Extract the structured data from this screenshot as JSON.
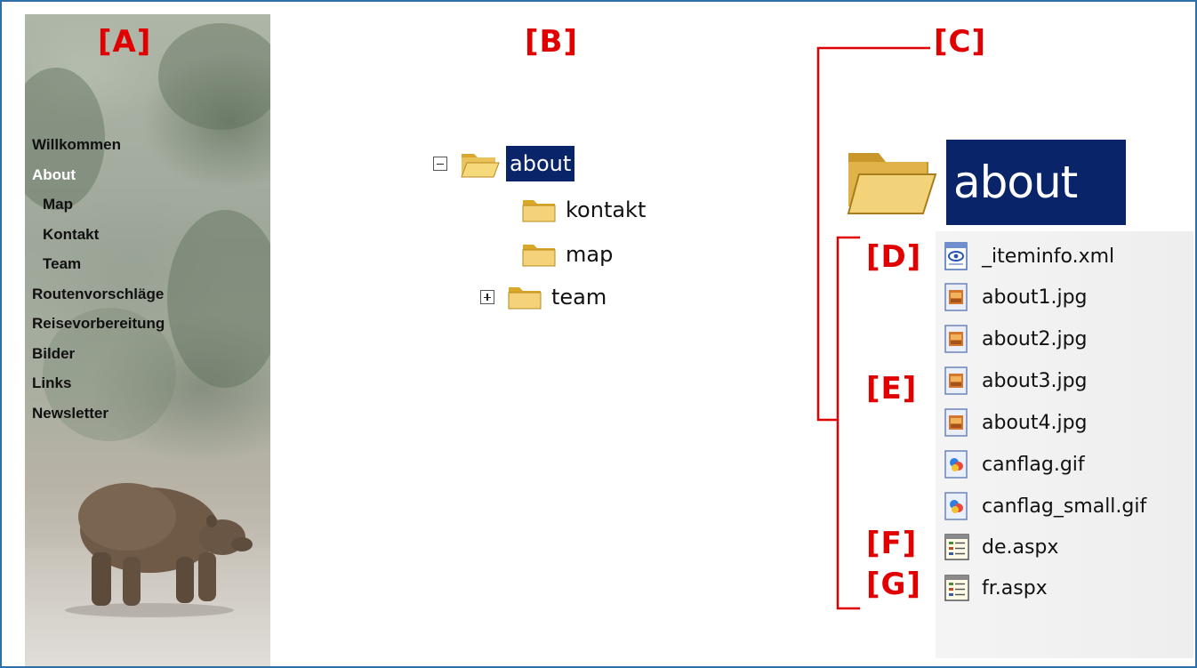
{
  "callouts": {
    "a": "[A]",
    "b": "[B]",
    "c": "[C]",
    "d": "[D]",
    "e": "[E]",
    "f": "[F]",
    "g": "[G]"
  },
  "sidebar": {
    "items": [
      {
        "label": "Willkommen",
        "level": 0,
        "active": false
      },
      {
        "label": "About",
        "level": 0,
        "active": true
      },
      {
        "label": "Map",
        "level": 1,
        "active": false
      },
      {
        "label": "Kontakt",
        "level": 1,
        "active": false
      },
      {
        "label": "Team",
        "level": 1,
        "active": false
      },
      {
        "label": "Routenvorschläge",
        "level": 0,
        "active": false
      },
      {
        "label": "Reisevorbereitung",
        "level": 0,
        "active": false
      },
      {
        "label": "Bilder",
        "level": 0,
        "active": false
      },
      {
        "label": "Links",
        "level": 0,
        "active": false
      },
      {
        "label": "Newsletter",
        "level": 0,
        "active": false
      }
    ]
  },
  "tree": {
    "root": {
      "label": "about",
      "state": "expanded",
      "selected": true
    },
    "children": [
      {
        "label": "kontakt",
        "expandable": false
      },
      {
        "label": "map",
        "expandable": false
      },
      {
        "label": "team",
        "expandable": true
      }
    ]
  },
  "folder_view": {
    "folder_label": "about",
    "files": [
      {
        "name": "_iteminfo.xml",
        "icon": "xml-file-icon"
      },
      {
        "name": "about1.jpg",
        "icon": "jpg-file-icon"
      },
      {
        "name": "about2.jpg",
        "icon": "jpg-file-icon"
      },
      {
        "name": "about3.jpg",
        "icon": "jpg-file-icon"
      },
      {
        "name": "about4.jpg",
        "icon": "jpg-file-icon"
      },
      {
        "name": "canflag.gif",
        "icon": "gif-file-icon"
      },
      {
        "name": "canflag_small.gif",
        "icon": "gif-file-icon"
      },
      {
        "name": "de.aspx",
        "icon": "aspx-file-icon"
      },
      {
        "name": "fr.aspx",
        "icon": "aspx-file-icon"
      }
    ]
  },
  "colors": {
    "callout": "#e00000",
    "selection": "#0a246a",
    "frame_border": "#2f6fa8"
  }
}
